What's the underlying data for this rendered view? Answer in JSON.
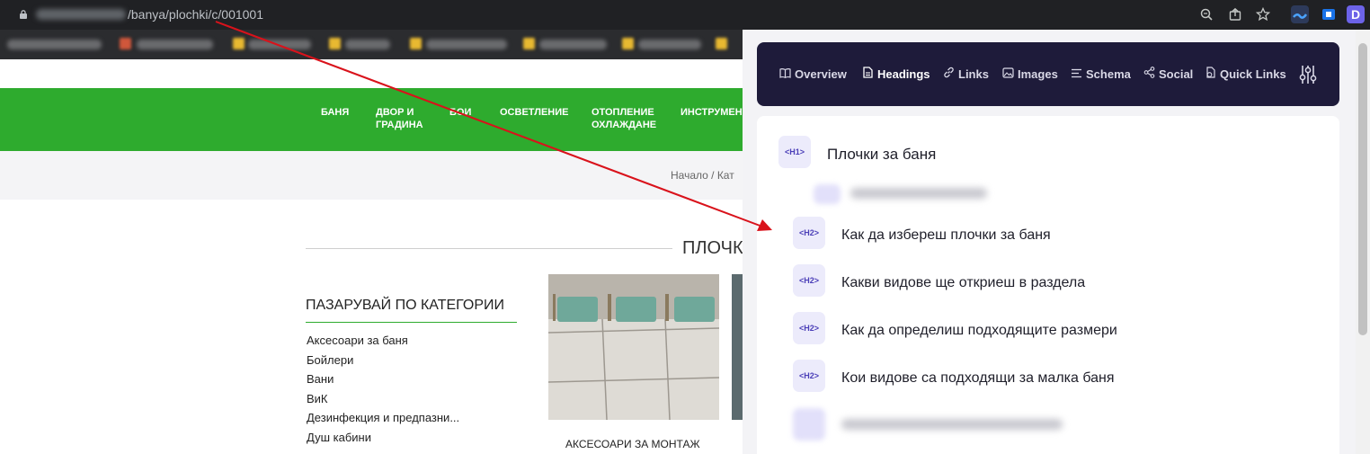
{
  "browser": {
    "url_visible": "/banya/plochki/c/001001",
    "icons": [
      "lock-icon",
      "zoom-icon",
      "share-icon",
      "star-icon"
    ],
    "extensions": [
      "extension-wave-icon",
      "extension-blue-icon",
      "extension-detailed-icon"
    ]
  },
  "site": {
    "nav": [
      {
        "label": "БАНЯ"
      },
      {
        "label": "ДВОР И\nГРАДИНА"
      },
      {
        "label": "БОИ"
      },
      {
        "label": "ОСВЕТЛЕНИЕ"
      },
      {
        "label": "ОТОПЛЕНИЕ\nОХЛАЖДАНЕ"
      },
      {
        "label": "ИНСТРУМЕНТ"
      }
    ],
    "breadcrumb": "Начало /  Кат",
    "page_heading": "ПЛОЧК",
    "categories_title": "ПАЗАРУВАЙ ПО КАТЕГОРИИ",
    "categories": [
      "Аксесоари за баня",
      "Бойлери",
      "Вани",
      "ВиК",
      " Дезинфекция и предпазни...",
      "Душ кабини"
    ],
    "product_name": "АКСЕСОАРИ ЗА МОНТАЖ"
  },
  "panel": {
    "tabs": [
      {
        "label": "Overview",
        "icon": "book-icon"
      },
      {
        "label": "Headings",
        "icon": "document-icon",
        "active": true
      },
      {
        "label": "Links",
        "icon": "link-icon"
      },
      {
        "label": "Images",
        "icon": "image-icon"
      },
      {
        "label": "Schema",
        "icon": "list-icon"
      },
      {
        "label": "Social",
        "icon": "share-nodes-icon"
      },
      {
        "label": "Quick Links",
        "icon": "quick-links-icon"
      }
    ],
    "settings_icon": "sliders-icon",
    "headings": [
      {
        "tag": "<H1>",
        "text": "Плочки за баня"
      },
      {
        "tag": "<H2>",
        "text": "Как да избереш плочки за баня"
      },
      {
        "tag": "<H2>",
        "text": "Какви видове ще откриеш в раздела"
      },
      {
        "tag": "<H2>",
        "text": "Как да определиш подходящите размери"
      },
      {
        "tag": "<H2>",
        "text": "Кои видове са подходящи за малка баня"
      }
    ]
  },
  "colors": {
    "nav_green": "#2eab2e",
    "panel_dark": "#1e1b3a",
    "tag_bg": "#ecebfb",
    "tag_text": "#4b3fb8",
    "arrow_red": "#d9121b"
  }
}
